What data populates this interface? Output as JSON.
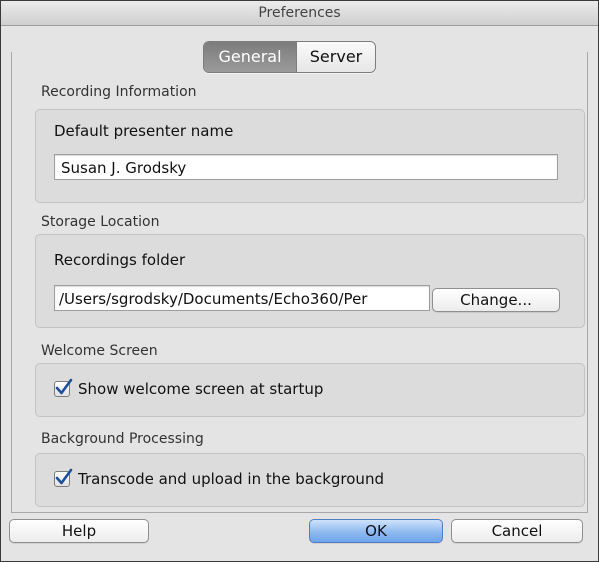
{
  "window": {
    "title": "Preferences"
  },
  "tabs": [
    {
      "label": "General",
      "active": true
    },
    {
      "label": "Server",
      "active": false
    }
  ],
  "recording_information": {
    "section_label": "Recording Information",
    "field_label": "Default presenter name",
    "presenter_name_value": "Susan J. Grodsky"
  },
  "storage_location": {
    "section_label": "Storage Location",
    "field_label": "Recordings folder",
    "folder_value": "/Users/sgrodsky/Documents/Echo360/Per",
    "change_button": "Change..."
  },
  "welcome_screen": {
    "section_label": "Welcome Screen",
    "checkbox_label": "Show welcome screen at startup",
    "checked": true
  },
  "background_processing": {
    "section_label": "Background Processing",
    "checkbox_label": "Transcode and upload in the background",
    "checked": true
  },
  "footer": {
    "help_button": "Help",
    "ok_button": "OK",
    "cancel_button": "Cancel"
  },
  "colors": {
    "accent": "#6fa4ea",
    "selected_tab": "#7c7c7c",
    "window_bg": "#e4e4e4"
  },
  "icons": {
    "checkbox_mark": "checkmark-icon"
  }
}
